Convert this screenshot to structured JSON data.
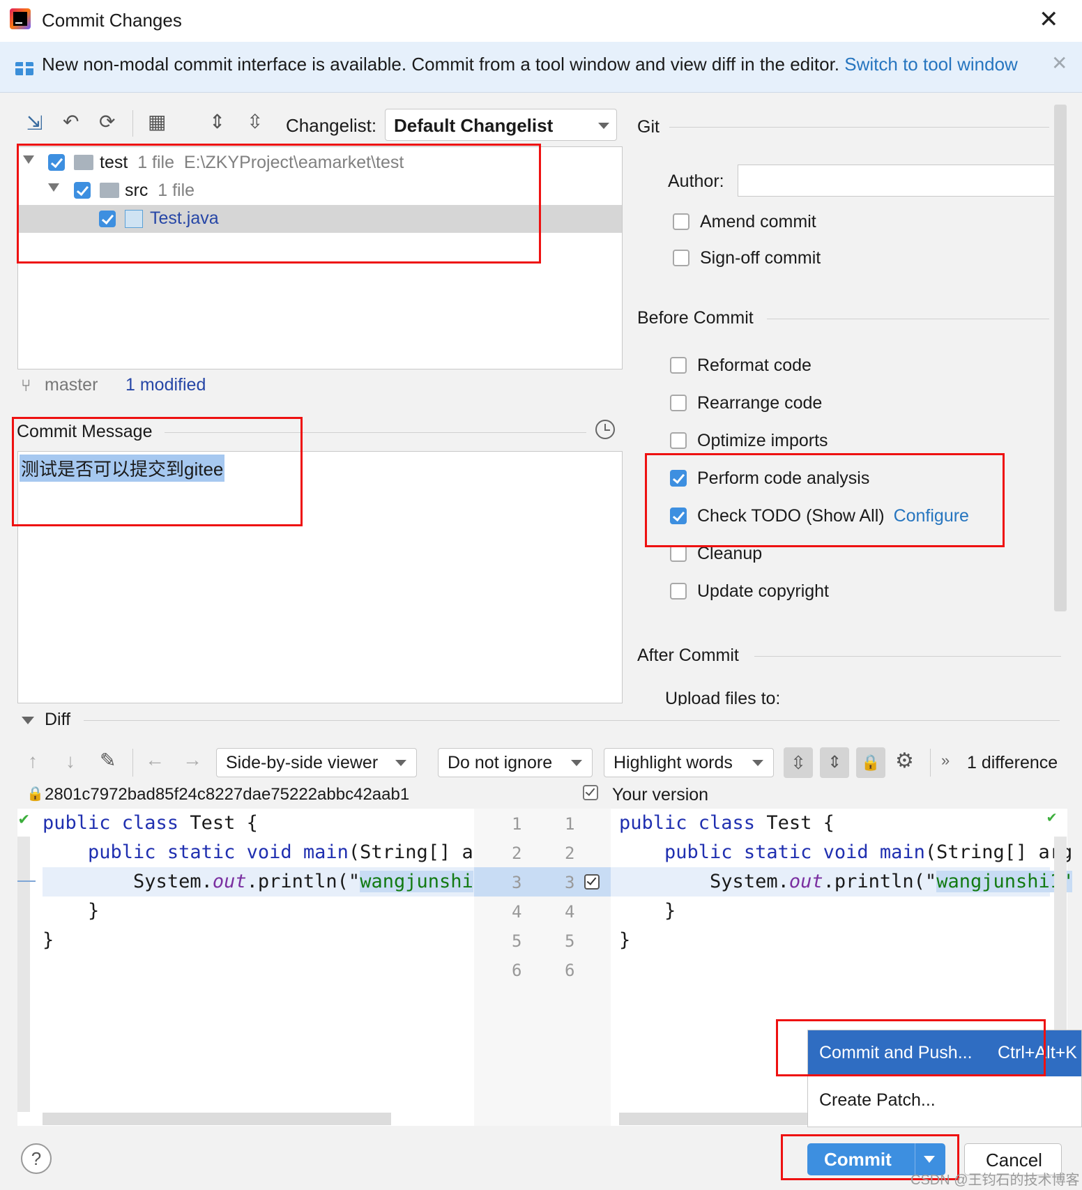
{
  "window": {
    "title": "Commit Changes"
  },
  "banner": {
    "text": "New non-modal commit interface is available. Commit from a tool window and view diff in the editor.",
    "link": "Switch to tool window"
  },
  "toolbar": {
    "changelist_label": "Changelist:",
    "changelist_value": "Default Changelist"
  },
  "tree": {
    "root": {
      "name": "test",
      "count": "1 file",
      "path": "E:\\ZKYProject\\eamarket\\test"
    },
    "child": {
      "name": "src",
      "count": "1 file"
    },
    "file": {
      "name": "Test.java"
    }
  },
  "branch": {
    "name": "master",
    "status": "1 modified"
  },
  "commit_message": {
    "label": "Commit Message",
    "text": "测试是否可以提交到gitee"
  },
  "git": {
    "title": "Git",
    "author_label": "Author:",
    "author_value": "",
    "amend": "Amend commit",
    "signoff": "Sign-off commit"
  },
  "before_commit": {
    "title": "Before Commit",
    "options": [
      {
        "label": "Reformat code",
        "checked": false
      },
      {
        "label": "Rearrange code",
        "checked": false
      },
      {
        "label": "Optimize imports",
        "checked": false
      },
      {
        "label": "Perform code analysis",
        "checked": true
      },
      {
        "label": "Check TODO (Show All)",
        "checked": true,
        "link": "Configure"
      },
      {
        "label": "Cleanup",
        "checked": false
      },
      {
        "label": "Update copyright",
        "checked": false
      }
    ]
  },
  "after_commit": {
    "title": "After Commit",
    "upload": "Upload files to:"
  },
  "diff": {
    "title": "Diff",
    "viewer": "Side-by-side viewer",
    "ignore": "Do not ignore",
    "highlight": "Highlight words",
    "difference": "1 difference",
    "left_header": "2801c7972bad85f24c8227dae75222abbc42aab1",
    "right_header": "Your version",
    "line_numbers": [
      "1",
      "2",
      "3",
      "4",
      "5",
      "6"
    ],
    "left_lines": {
      "l1_kw": "public class",
      "l1_rest": " Test {",
      "l2_kw1": "public static void",
      "l2_fn": " main",
      "l2_rest": "(String[] a",
      "l3_pre": "System.",
      "l3_it": "out",
      "l3_mid": ".println(\"",
      "l3_str": "wangjunshi",
      "l4": "}",
      "l5": "}"
    },
    "right_lines": {
      "l1_kw": "public class",
      "l1_rest": " Test {",
      "l2_kw1": "public static void",
      "l2_fn": " main",
      "l2_rest": "(String[] arg",
      "l3_pre": "System.",
      "l3_it": "out",
      "l3_mid": ".println(\"",
      "l3_str": "wangjunshi1\"",
      "l4": "}",
      "l5": "}"
    }
  },
  "popup": {
    "commit_push": "Commit and Push...",
    "shortcut": "Ctrl+Alt+K",
    "create_patch": "Create Patch..."
  },
  "buttons": {
    "commit": "Commit",
    "cancel": "Cancel",
    "help": "?"
  },
  "watermark": "CSDN @王钧石的技术博客",
  "colors": {
    "accent": "#3d8fe0",
    "link": "#2675bf",
    "highlight_box": "#e11111",
    "menu_selected": "#2f6dc2"
  }
}
